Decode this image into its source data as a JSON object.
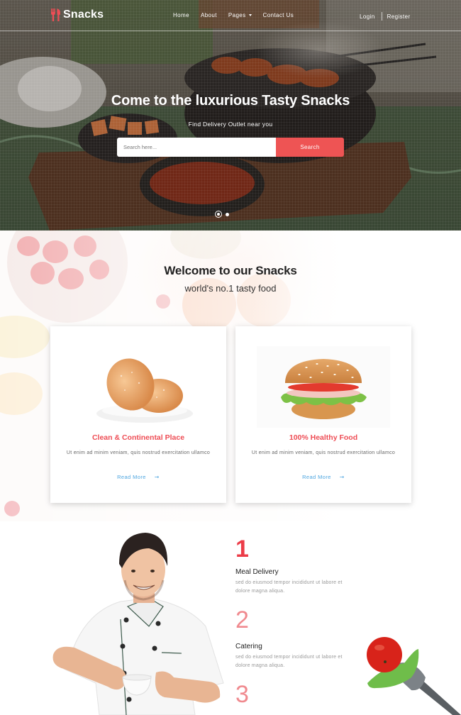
{
  "brand": {
    "name": "Snacks",
    "accent": "#ee5454"
  },
  "nav": {
    "items": [
      {
        "label": "Home"
      },
      {
        "label": "About"
      },
      {
        "label": "Pages",
        "dropdown": true
      },
      {
        "label": "Contact Us"
      }
    ],
    "login": "Login",
    "register": "Register"
  },
  "hero": {
    "title_regular": "Come to the luxurious ",
    "title_bold": "Tasty Snacks",
    "subtitle": "Find Delivery Outlet near you",
    "search_placeholder": "Search here...",
    "search_value": "",
    "search_button": "Search",
    "slides": 2,
    "active_slide": 1
  },
  "welcome": {
    "title": "Welcome to our Snacks",
    "subtitle": "world's no.1 tasty food",
    "cards": [
      {
        "image": "donuts",
        "title": "Clean & Continental Place",
        "text": "Ut enim ad minim veniam, quis nostrud exercitation ullamco",
        "link": "Read More",
        "link_icon": "arrow-right-icon"
      },
      {
        "image": "burger",
        "title": "100% Healthy Food",
        "text": "Ut enim ad minim veniam, quis nostrud exercitation ullamco",
        "link": "Read More",
        "link_icon": "arrow-right-icon"
      }
    ]
  },
  "features": {
    "items": [
      {
        "number": "1",
        "title": "Meal Delivery",
        "text": "sed do eiusmod tempor incididunt ut labore et dolore magna aliqua."
      },
      {
        "number": "2",
        "title": "Catering",
        "text": "sed do eiusmod tempor incididunt ut labore et dolore magna aliqua."
      },
      {
        "number": "3"
      }
    ]
  }
}
